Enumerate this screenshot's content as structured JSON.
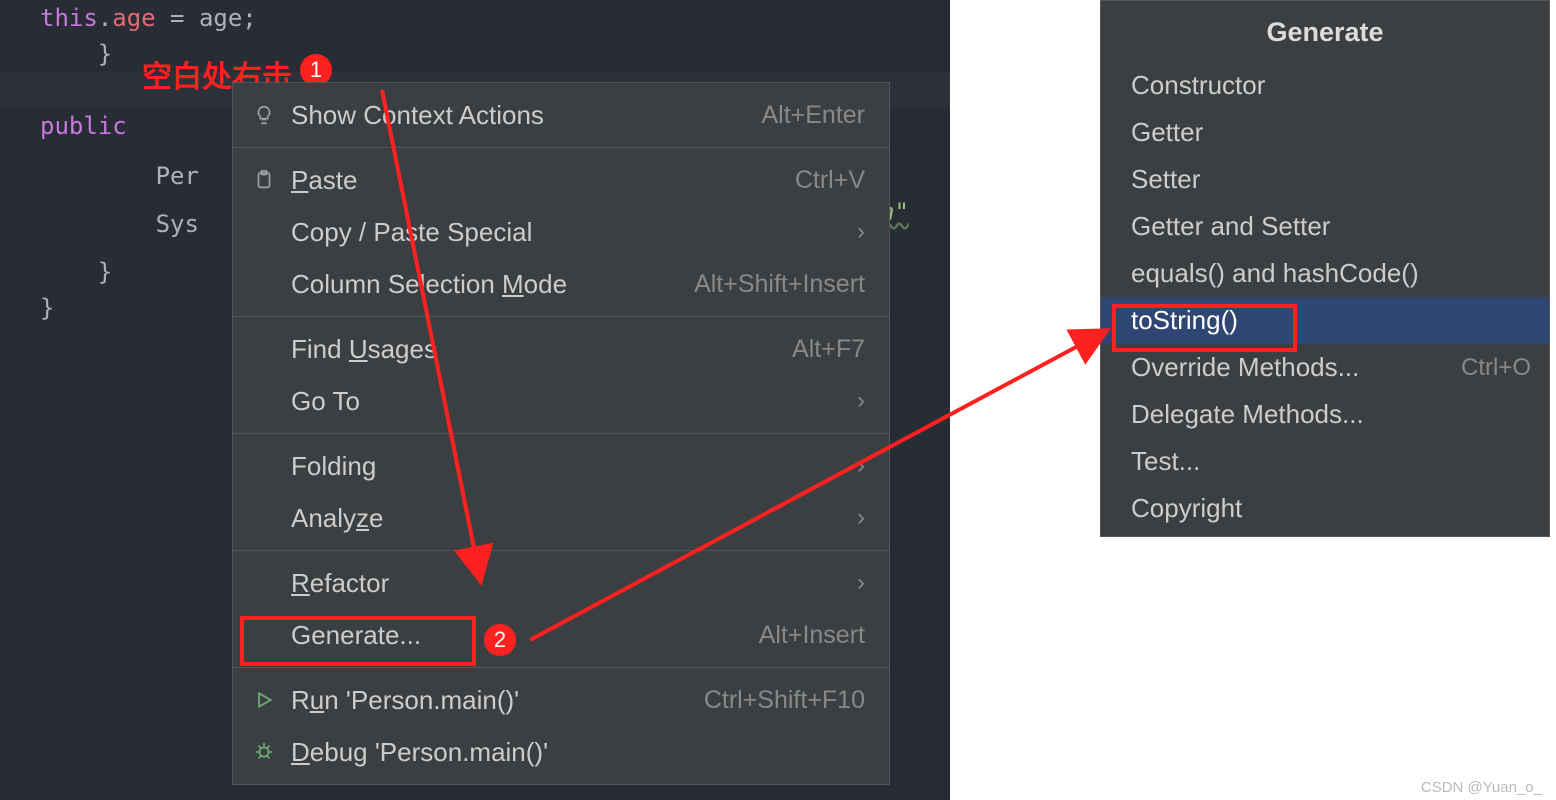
{
  "code": {
    "line1_pre": "        ",
    "line1_this": "this",
    "line1_dot": ".",
    "line1_prop": "age",
    "line1_eq": " = age;",
    "line2": "    }",
    "line3": "",
    "line4_pre": "    ",
    "line4_kw": "public ",
    "line5": "        Per",
    "line5_end": "n\"",
    "line6": "        Sys",
    "line7": "    }",
    "line8": "}"
  },
  "annotation": {
    "rightClickLabel": "空白处右击",
    "step1": "1",
    "step2": "2"
  },
  "contextMenu": {
    "items": [
      {
        "label": "Show Context Actions",
        "shortcut": "Alt+Enter",
        "icon": "bulb"
      },
      {
        "sep": true
      },
      {
        "label": "Paste",
        "shortcut": "Ctrl+V",
        "underline": 0,
        "icon": "clipboard"
      },
      {
        "label": "Copy / Paste Special",
        "submenu": true
      },
      {
        "label": "Column Selection Mode",
        "shortcut": "Alt+Shift+Insert",
        "underline": 17
      },
      {
        "sep": true
      },
      {
        "label": "Find Usages",
        "shortcut": "Alt+F7",
        "underline": 5
      },
      {
        "label": "Go To",
        "submenu": true
      },
      {
        "sep": true
      },
      {
        "label": "Folding",
        "submenu": true
      },
      {
        "label": "Analyze",
        "submenu": true,
        "underline": 5
      },
      {
        "sep": true
      },
      {
        "label": "Refactor",
        "submenu": true,
        "underline": 0
      },
      {
        "label": "Generate...",
        "shortcut": "Alt+Insert",
        "highlight": true
      },
      {
        "sep": true
      },
      {
        "label": "Run 'Person.main()'",
        "shortcut": "Ctrl+Shift+F10",
        "underline": 1,
        "icon": "run"
      },
      {
        "label": "Debug 'Person.main()'",
        "underline": 0,
        "icon": "debug"
      }
    ]
  },
  "popup": {
    "title": "Generate",
    "items": [
      {
        "label": "Constructor"
      },
      {
        "label": "Getter"
      },
      {
        "label": "Setter"
      },
      {
        "label": "Getter and Setter"
      },
      {
        "label": "equals() and hashCode()"
      },
      {
        "label": "toString()",
        "selected": true,
        "highlight": true
      },
      {
        "label": "Override Methods...",
        "shortcut": "Ctrl+O"
      },
      {
        "label": "Delegate Methods..."
      },
      {
        "label": "Test..."
      },
      {
        "label": "Copyright"
      }
    ]
  },
  "watermark": "CSDN @Yuan_o_"
}
